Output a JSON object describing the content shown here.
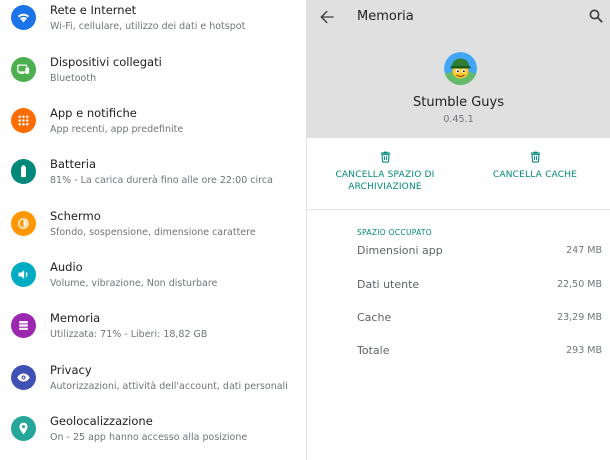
{
  "settings": {
    "items": [
      {
        "title": "Rete e Internet",
        "subtitle": "Wi-Fi, cellulare, utilizzo dei dati e hotspot",
        "icon": "wifi-icon",
        "color": "#1a73e8"
      },
      {
        "title": "Dispositivi collegati",
        "subtitle": "Bluetooth",
        "icon": "devices-icon",
        "color": "#4caf50"
      },
      {
        "title": "App e notifiche",
        "subtitle": "App recenti, app predefinite",
        "icon": "apps-grid-icon",
        "color": "#ff6d00"
      },
      {
        "title": "Batteria",
        "subtitle": "81% - La carica durerà fino alle ore 22:00 circa",
        "icon": "battery-icon",
        "color": "#00897b"
      },
      {
        "title": "Schermo",
        "subtitle": "Sfondo, sospensione, dimensione carattere",
        "icon": "brightness-icon",
        "color": "#ff9800"
      },
      {
        "title": "Audio",
        "subtitle": "Volume, vibrazione, Non disturbare",
        "icon": "volume-icon",
        "color": "#00acc1"
      },
      {
        "title": "Memoria",
        "subtitle": "Utilizzata: 71% - Liberi: 18,82 GB",
        "icon": "storage-icon",
        "color": "#9c27b0"
      },
      {
        "title": "Privacy",
        "subtitle": "Autorizzazioni, attività dell'account, dati personali",
        "icon": "privacy-eye-icon",
        "color": "#3f51b5"
      },
      {
        "title": "Geolocalizzazione",
        "subtitle": "On - 25 app hanno accesso alla posizione",
        "icon": "location-pin-icon",
        "color": "#26a69a"
      }
    ]
  },
  "storage": {
    "header_title": "Memoria",
    "app_name": "Stumble Guys",
    "app_version": "0.45.1",
    "clear_storage_label": "CANCELLA SPAZIO DI ARCHIVIAZIONE",
    "clear_cache_label": "CANCELLA CACHE",
    "section_header": "SPAZIO OCCUPATO",
    "rows": [
      {
        "label": "Dimensioni app",
        "value": "247 MB"
      },
      {
        "label": "Dati utente",
        "value": "22,50 MB"
      },
      {
        "label": "Cache",
        "value": "23,29 MB"
      },
      {
        "label": "Totale",
        "value": "293 MB"
      }
    ],
    "accent_color": "#00897b"
  }
}
